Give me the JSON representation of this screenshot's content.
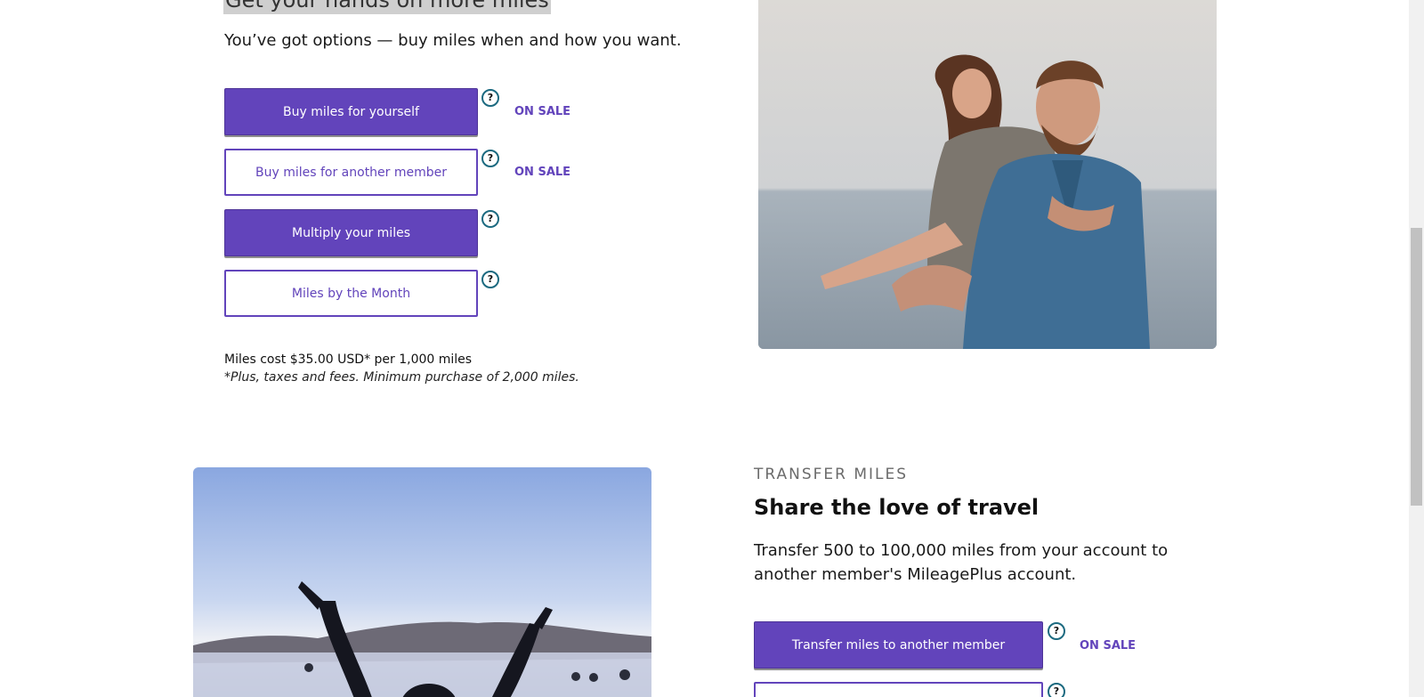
{
  "section_buy": {
    "title": "Get your hands on more miles",
    "subtitle": "You’ve got options — buy miles when and how you want.",
    "buttons": [
      {
        "label": "Buy miles for yourself",
        "badge": "ON SALE"
      },
      {
        "label": "Buy miles for another member",
        "badge": "ON SALE"
      },
      {
        "label": "Multiply your miles",
        "badge": ""
      },
      {
        "label": "Miles by the Month",
        "badge": ""
      }
    ],
    "help_glyph": "?",
    "cost": "Miles cost $35.00 USD* per 1,000 miles",
    "cost_note": "*Plus, taxes and fees. Minimum purchase of 2,000 miles."
  },
  "section_transfer": {
    "eyebrow": "TRANSFER MILES",
    "title": "Share the love of travel",
    "description": "Transfer 500 to 100,000 miles from your account to another member's MileagePlus account.",
    "buttons": [
      {
        "label": "Transfer miles to another member",
        "badge": "ON SALE"
      },
      {
        "label": "",
        "badge": ""
      }
    ]
  },
  "colors": {
    "brand_purple": "#6244bb",
    "help_ring": "#1c6a80"
  },
  "icons": {
    "help": "question-circle-icon"
  }
}
